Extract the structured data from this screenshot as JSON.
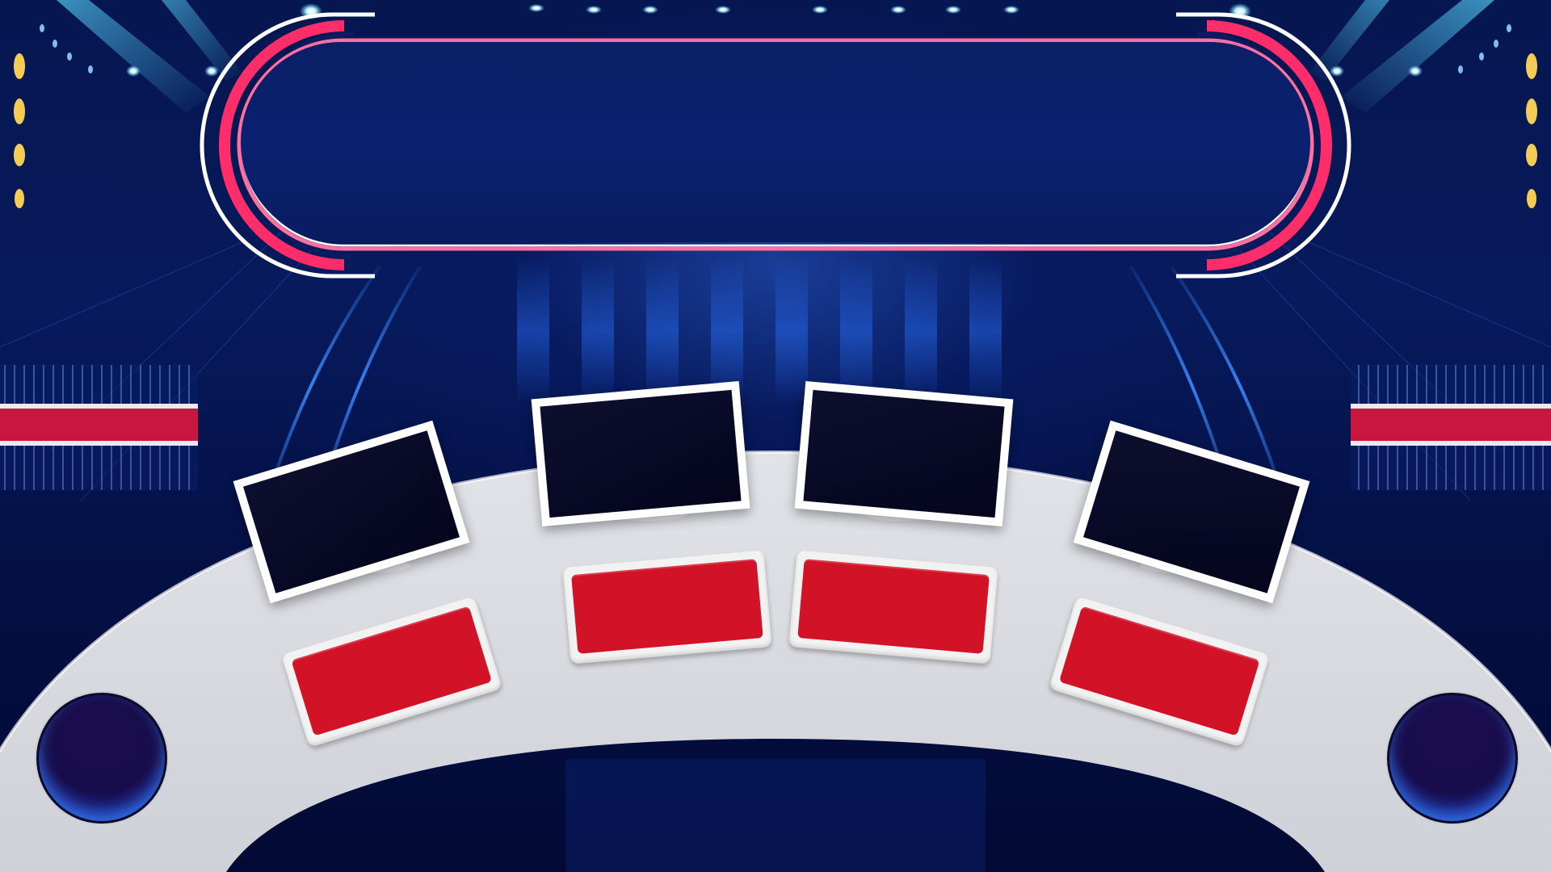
{
  "scene": {
    "marquee_text": "",
    "podiums": [
      {
        "id": 1,
        "monitor_text": "",
        "buzzer_text": ""
      },
      {
        "id": 2,
        "monitor_text": "",
        "buzzer_text": ""
      },
      {
        "id": 3,
        "monitor_text": "",
        "buzzer_text": ""
      },
      {
        "id": 4,
        "monitor_text": "",
        "buzzer_text": ""
      }
    ]
  },
  "colors": {
    "background": "#061650",
    "marquee_fill": "#0b2170",
    "neon_red": "#ff2d6a",
    "neon_white": "#ffffff",
    "desk": "#d4d6dd",
    "buzzer_red": "#d21227",
    "monitor_screen": "#070925",
    "orb_glow": "#2f6ff0"
  },
  "icons": {
    "stage_lights": "spotlight-icon",
    "marker_lights": "yellow-bulb-icon"
  }
}
